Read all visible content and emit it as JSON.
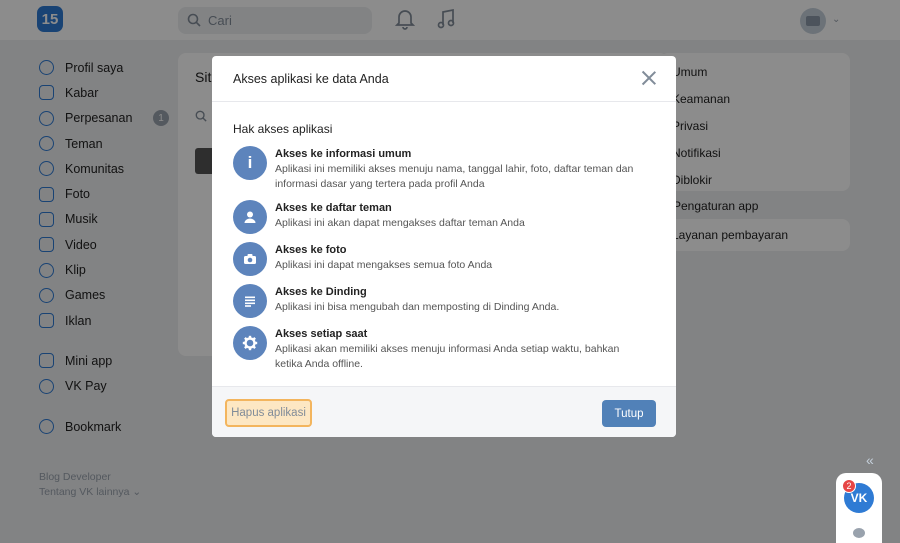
{
  "topbar": {
    "logo_text": "15",
    "search_placeholder": "Cari"
  },
  "nav": {
    "items": [
      {
        "label": "Profil saya",
        "icon": "user-circle-icon"
      },
      {
        "label": "Kabar",
        "icon": "news-icon"
      },
      {
        "label": "Perpesanan",
        "icon": "chat-bubble-icon",
        "badge": "1"
      },
      {
        "label": "Teman",
        "icon": "friends-icon"
      },
      {
        "label": "Komunitas",
        "icon": "communities-icon"
      },
      {
        "label": "Foto",
        "icon": "photo-icon"
      },
      {
        "label": "Musik",
        "icon": "music-note-icon"
      },
      {
        "label": "Video",
        "icon": "video-icon"
      },
      {
        "label": "Klip",
        "icon": "clips-icon"
      },
      {
        "label": "Games",
        "icon": "gamepad-icon"
      },
      {
        "label": "Iklan",
        "icon": "ads-icon"
      }
    ],
    "items2": [
      {
        "label": "Mini app",
        "icon": "apps-grid-icon"
      },
      {
        "label": "VK Pay",
        "icon": "vkpay-icon"
      }
    ],
    "items3": [
      {
        "label": "Bookmark",
        "icon": "star-icon"
      }
    ],
    "footer_line1": "Blog   Developer",
    "footer_line2": "Tentang VK   lainnya ⌄"
  },
  "background": {
    "mid_title": "Sit",
    "right_menu": [
      "Umum",
      "Keamanan",
      "Privasi",
      "Notifikasi",
      "Diblokir"
    ],
    "right_active": "Pengaturan app",
    "right_menu2": "Layanan pembayaran"
  },
  "modal": {
    "title": "Akses aplikasi ke data Anda",
    "section_title": "Hak akses aplikasi",
    "permissions": [
      {
        "icon": "info-icon",
        "title": "Akses ke informasi umum",
        "desc": "Aplikasi ini memiliki akses menuju nama, tanggal lahir, foto, daftar teman dan informasi dasar yang tertera pada profil Anda"
      },
      {
        "icon": "person-icon",
        "title": "Akses ke daftar teman",
        "desc": "Aplikasi ini akan dapat mengakses daftar teman Anda"
      },
      {
        "icon": "camera-icon",
        "title": "Akses ke foto",
        "desc": "Aplikasi ini dapat mengakses semua foto Anda"
      },
      {
        "icon": "wall-post-icon",
        "title": "Akses ke Dinding",
        "desc": "Aplikasi ini bisa mengubah dan memposting di Dinding Anda."
      },
      {
        "icon": "gear-icon",
        "title": "Akses setiap saat",
        "desc": "Aplikasi akan memiliki akses menuju informasi Anda setiap waktu, bahkan ketika Anda offline."
      }
    ],
    "delete_button": "Hapus aplikasi",
    "close_button": "Tutup"
  },
  "widget": {
    "logo_text": "VK",
    "badge": "2",
    "collapse": "«"
  },
  "colors": {
    "accent": "#2f7bd4",
    "button": "#5181b8",
    "highlight": "#f3b55e"
  }
}
